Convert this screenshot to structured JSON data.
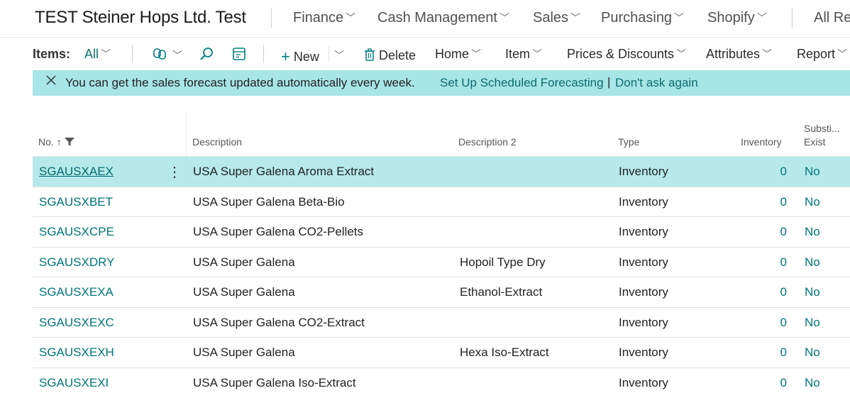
{
  "company": "TEST Steiner Hops Ltd. Test",
  "nav": {
    "finance": "Finance",
    "cash_management": "Cash Management",
    "sales": "Sales",
    "purchasing": "Purchasing",
    "shopify": "Shopify",
    "all_reports": "All Re"
  },
  "actions": {
    "items_label": "Items:",
    "filter": "All",
    "new": "New",
    "delete": "Delete",
    "home": "Home",
    "item": "Item",
    "prices_discounts": "Prices & Discounts",
    "attributes": "Attributes",
    "report": "Report"
  },
  "icons": {
    "copilot": "copilot-icon",
    "search": "search-icon",
    "edit_list": "edit-list-icon",
    "plus": "plus-icon",
    "trash": "trash-icon",
    "close": "close-icon",
    "filter": "filter-icon",
    "sort": "sort-ascending-icon",
    "more": "more-vertical-icon"
  },
  "notification": {
    "message": "You can get the sales forecast updated automatically every week.",
    "link_setup": "Set Up Scheduled Forecasting",
    "separator": "|",
    "link_dismiss": "Don't ask again"
  },
  "table": {
    "headers": {
      "no": "No.",
      "description": "Description",
      "description2": "Description 2",
      "type": "Type",
      "inventory": "Inventory",
      "subst_line1": "Substi...",
      "subst_line2": "Exist"
    },
    "rows": [
      {
        "no": "SGAUSXAEX",
        "description": "USA Super Galena Aroma Extract",
        "description2": "",
        "type": "Inventory",
        "inventory": "0",
        "subst": "No"
      },
      {
        "no": "SGAUSXBET",
        "description": "USA Super Galena Beta-Bio",
        "description2": "",
        "type": "Inventory",
        "inventory": "0",
        "subst": "No"
      },
      {
        "no": "SGAUSXCPE",
        "description": "USA Super Galena CO2-Pellets",
        "description2": "",
        "type": "Inventory",
        "inventory": "0",
        "subst": "No"
      },
      {
        "no": "SGAUSXDRY",
        "description": "USA Super Galena",
        "description2": "Hopoil Type Dry",
        "type": "Inventory",
        "inventory": "0",
        "subst": "No"
      },
      {
        "no": "SGAUSXEXA",
        "description": "USA Super Galena",
        "description2": "Ethanol-Extract",
        "type": "Inventory",
        "inventory": "0",
        "subst": "No"
      },
      {
        "no": "SGAUSXEXC",
        "description": "USA Super Galena CO2-Extract",
        "description2": "",
        "type": "Inventory",
        "inventory": "0",
        "subst": "No"
      },
      {
        "no": "SGAUSXEXH",
        "description": "USA Super Galena",
        "description2": "Hexa Iso-Extract",
        "type": "Inventory",
        "inventory": "0",
        "subst": "No"
      },
      {
        "no": "SGAUSXEXI",
        "description": "USA Super Galena Iso-Extract",
        "description2": "",
        "type": "Inventory",
        "inventory": "0",
        "subst": "No"
      }
    ]
  },
  "colors": {
    "accent": "#00757a",
    "notification_bg": "#a7e5e7",
    "selected_row_bg": "#b7e9eb"
  }
}
